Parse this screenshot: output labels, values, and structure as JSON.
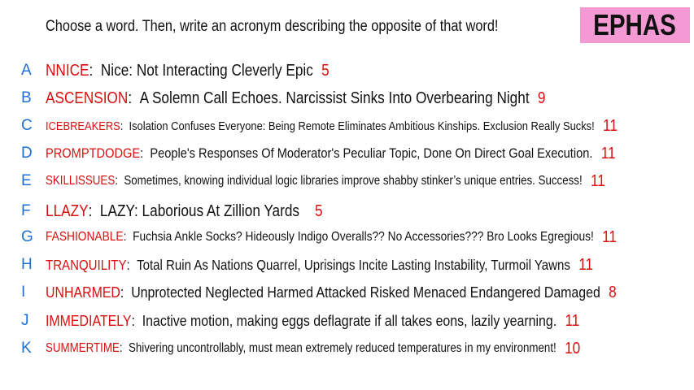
{
  "header": {
    "prompt": "Choose a word. Then, write an acronym describing the opposite of that word!",
    "tag": "EPHAS"
  },
  "entries": [
    {
      "letter": "A",
      "word": "NNICE",
      "definition": "Nice: Not Interacting Cleverly Epic",
      "count": "5"
    },
    {
      "letter": "B",
      "word": "ASCENSION",
      "definition": "A Solemn Call Echoes. Narcissist Sinks Into Overbearing Night",
      "count": "9"
    },
    {
      "letter": "C",
      "word": "ICEBREAKERS",
      "definition": "Isolation Confuses Everyone: Being Remote Eliminates Ambitious Kinships. Exclusion Really Sucks!",
      "count": "11"
    },
    {
      "letter": "D",
      "word": "PROMPTDODGE",
      "definition": "People's Responses Of Moderator's Peculiar Topic, Done On Direct Goal Execution.",
      "count": "11"
    },
    {
      "letter": "E",
      "word": "SKILLISSUES",
      "definition": "Sometimes, knowing individual logic libraries improve shabby stinker’s unique entries. Success!",
      "count": "11"
    },
    {
      "letter": "F",
      "word": "LLAZY",
      "definition": "LAZY: Laborious At Zillion Yards",
      "count": "5"
    },
    {
      "letter": "G",
      "word": "FASHIONABLE",
      "definition": "Fuchsia Ankle Socks? Hideously Indigo Overalls?? No Accessories??? Bro Looks Egregious!",
      "count": "11"
    },
    {
      "letter": "H",
      "word": "TRANQUILITY",
      "definition": "Total Ruin As Nations Quarrel, Uprisings Incite Lasting Instability, Turmoil Yawns",
      "count": "11"
    },
    {
      "letter": "I",
      "word": "UNHARMED",
      "definition": "Unprotected Neglected Harmed Attacked Risked Menaced Endangered Damaged",
      "count": "8"
    },
    {
      "letter": "J",
      "word": "IMMEDIATELY",
      "definition": "Inactive motion, making eggs deflagrate if all takes eons, lazily yearning.",
      "count": "11"
    },
    {
      "letter": "K",
      "word": "SUMMERTIME",
      "definition": "Shivering uncontrollably, must mean extremely reduced temperatures in my environment!",
      "count": "10"
    }
  ]
}
